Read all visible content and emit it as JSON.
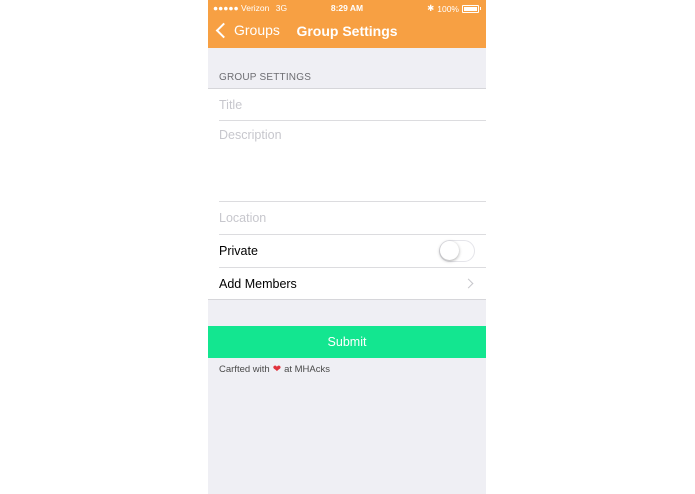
{
  "status_bar": {
    "carrier": "●●●●● Verizon",
    "network": "3G",
    "time": "8:29 AM",
    "bluetooth": "✱",
    "battery": "100%"
  },
  "nav": {
    "back_label": "Groups",
    "title": "Group Settings"
  },
  "form": {
    "section_header": "GROUP SETTINGS",
    "title_placeholder": "Title",
    "description_placeholder": "Description",
    "location_placeholder": "Location",
    "private_label": "Private",
    "private_on": false,
    "add_members_label": "Add Members"
  },
  "submit_label": "Submit",
  "footer": {
    "prefix": "Carfted with",
    "heart": "❤",
    "suffix": "at MHAcks"
  },
  "colors": {
    "navbar": "#f7a043",
    "submit": "#13e690",
    "background": "#efeff4"
  }
}
